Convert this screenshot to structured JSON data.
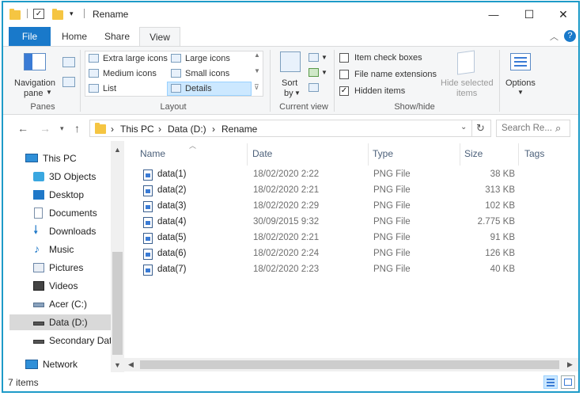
{
  "titlebar": {
    "title": "Rename",
    "minimize_glyph": "—",
    "maximize_glyph": "☐",
    "close_glyph": "✕"
  },
  "ribbon_tabs": [
    {
      "label": "File"
    },
    {
      "label": "Home"
    },
    {
      "label": "Share"
    },
    {
      "label": "View"
    }
  ],
  "ribbon": {
    "panes": {
      "navigation_pane_label": "Navigation",
      "navigation_pane_label2": "pane",
      "group_label": "Panes"
    },
    "layout": {
      "options": [
        "Extra large icons",
        "Large icons",
        "Medium icons",
        "Small icons",
        "List",
        "Details"
      ],
      "selected": "Details",
      "group_label": "Layout"
    },
    "current_view": {
      "sort_label": "Sort",
      "sort_label2": "by",
      "group_label": "Current view"
    },
    "show_hide": {
      "item_check_boxes": "Item check boxes",
      "file_name_extensions": "File name extensions",
      "hidden_items": "Hidden items",
      "hide_selected_label": "Hide selected",
      "hide_selected_label2": "items",
      "group_label": "Show/hide",
      "checked": {
        "item_check_boxes": false,
        "file_name_extensions": false,
        "hidden_items": true
      }
    },
    "options_label": "Options"
  },
  "address": {
    "crumbs": [
      "This PC",
      "Data  (D:)",
      "Rename"
    ],
    "search_placeholder": "Search Re..."
  },
  "nav_tree": [
    {
      "label": "This PC",
      "icon": "pc-icon"
    },
    {
      "label": "3D Objects",
      "icon": "3d-objects-icon"
    },
    {
      "label": "Desktop",
      "icon": "desktop-icon"
    },
    {
      "label": "Documents",
      "icon": "documents-icon"
    },
    {
      "label": "Downloads",
      "icon": "downloads-icon"
    },
    {
      "label": "Music",
      "icon": "music-icon"
    },
    {
      "label": "Pictures",
      "icon": "pictures-icon"
    },
    {
      "label": "Videos",
      "icon": "videos-icon"
    },
    {
      "label": "Acer (C:)",
      "icon": "drive-icon"
    },
    {
      "label": "Data  (D:)",
      "icon": "drive-icon"
    },
    {
      "label": "Secondary Data",
      "icon": "drive-icon"
    },
    {
      "label": "Network",
      "icon": "network-icon"
    }
  ],
  "columns": [
    "Name",
    "Date",
    "Type",
    "Size",
    "Tags"
  ],
  "files": [
    {
      "name": "data(1)",
      "date": "18/02/2020 2:22",
      "type": "PNG File",
      "size": "38 KB"
    },
    {
      "name": "data(2)",
      "date": "18/02/2020 2:21",
      "type": "PNG File",
      "size": "313 KB"
    },
    {
      "name": "data(3)",
      "date": "18/02/2020 2:29",
      "type": "PNG File",
      "size": "102 KB"
    },
    {
      "name": "data(4)",
      "date": "30/09/2015 9:32",
      "type": "PNG File",
      "size": "2.775 KB"
    },
    {
      "name": "data(5)",
      "date": "18/02/2020 2:21",
      "type": "PNG File",
      "size": "91 KB"
    },
    {
      "name": "data(6)",
      "date": "18/02/2020 2:24",
      "type": "PNG File",
      "size": "126 KB"
    },
    {
      "name": "data(7)",
      "date": "18/02/2020 2:23",
      "type": "PNG File",
      "size": "40 KB"
    }
  ],
  "status": {
    "item_count": "7 items"
  },
  "colors": {
    "accent": "#1979ca",
    "window_border": "#1e9bc8",
    "selection": "#cce8ff",
    "folder": "#f5c542"
  }
}
